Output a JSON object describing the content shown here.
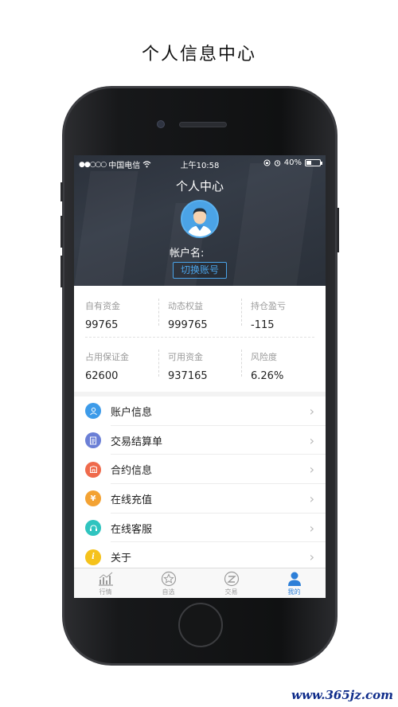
{
  "page_title": "个人信息中心",
  "status_bar": {
    "carrier": "中国电信",
    "time": "上午10:58",
    "battery": "40%",
    "battery_level": 0.4
  },
  "header": {
    "title": "个人中心",
    "account_label": "帐户名:",
    "switch_button": "切换账号"
  },
  "stats": [
    {
      "label": "自有资金",
      "value": "99765"
    },
    {
      "label": "动态权益",
      "value": "999765"
    },
    {
      "label": "持仓盈亏",
      "value": "-115"
    },
    {
      "label": "占用保证金",
      "value": "62600"
    },
    {
      "label": "可用资金",
      "value": "937165"
    },
    {
      "label": "风险度",
      "value": "6.26%"
    }
  ],
  "menu": [
    {
      "label": "账户信息",
      "icon": "user-icon",
      "color": "#3d9be9"
    },
    {
      "label": "交易结算单",
      "icon": "statement-icon",
      "color": "#6b7fd6"
    },
    {
      "label": "合约信息",
      "icon": "contract-icon",
      "color": "#ef6a4c"
    },
    {
      "label": "在线充值",
      "icon": "yuan-icon",
      "color": "#f3a233"
    },
    {
      "label": "在线客服",
      "icon": "service-icon",
      "color": "#2fc4bf"
    },
    {
      "label": "关于",
      "icon": "info-icon",
      "color": "#f5c21b"
    }
  ],
  "tabs": [
    {
      "label": "行情",
      "icon": "chart-icon"
    },
    {
      "label": "自选",
      "icon": "star-icon"
    },
    {
      "label": "交易",
      "icon": "trade-icon"
    },
    {
      "label": "我的",
      "icon": "person-icon",
      "active": true
    }
  ],
  "colors": {
    "accent": "#2d7fd8",
    "header_bg": "#2f3540"
  },
  "watermark": "www.365jz.com"
}
